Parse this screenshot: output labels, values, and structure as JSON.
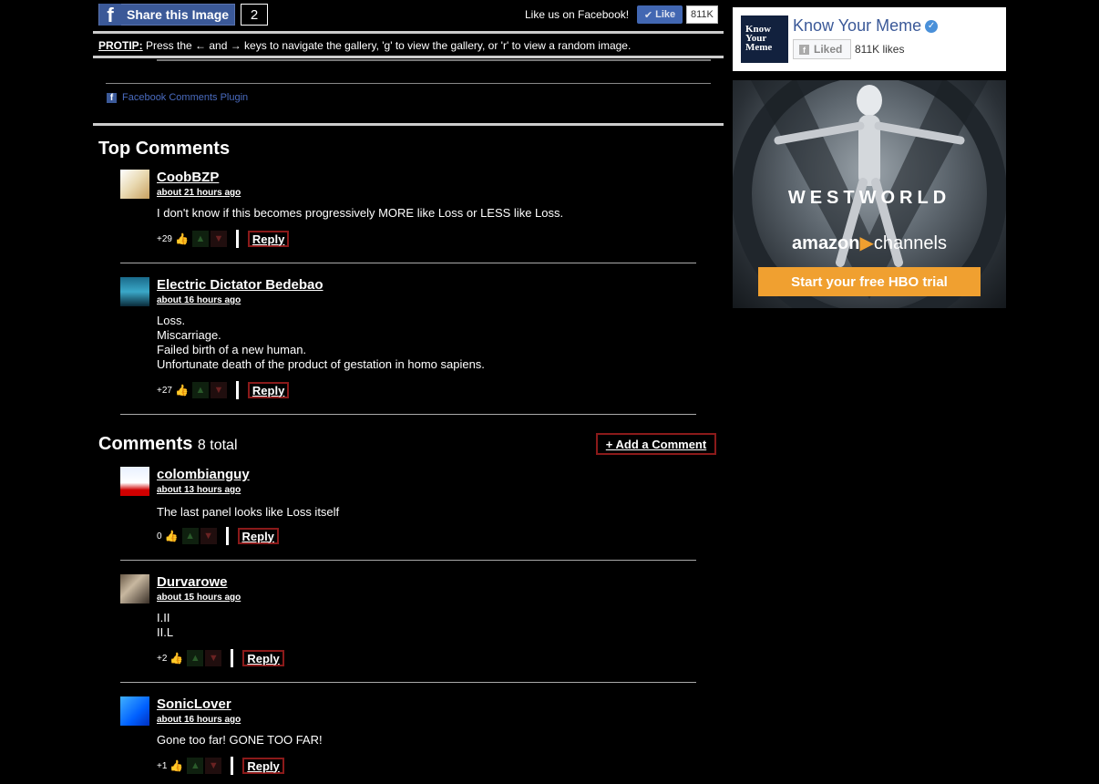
{
  "share": {
    "button_label": "Share this Image",
    "count": "2",
    "like_us": "Like us on Facebook!",
    "like_button": "Like",
    "like_count": "811K"
  },
  "protip": {
    "label": "PROTIP:",
    "text": " Press the ← and → keys to navigate the gallery, 'g' to view the gallery, or 'r' to view a random image."
  },
  "fb_plugin": {
    "label": "Facebook Comments Plugin"
  },
  "top_comments": {
    "title": "Top Comments",
    "items": [
      {
        "user": "CoobBZP",
        "time": "about 21 hours ago",
        "lines": [
          "I don't know if this becomes progressively MORE like Loss or LESS like Loss."
        ],
        "score": "+29",
        "reply": "Reply"
      },
      {
        "user": "Electric Dictator Bedebao",
        "time": "about 16 hours ago",
        "lines": [
          "Loss.",
          "Miscarriage.",
          "Failed birth of a new human.",
          "Unfortunate death of the product of gestation in homo sapiens."
        ],
        "score": "+27",
        "reply": "Reply"
      }
    ]
  },
  "comments": {
    "title": "Comments",
    "total": "8 total",
    "add_label": "+ Add a Comment",
    "items": [
      {
        "user": "colombianguy",
        "time": "about 13 hours ago",
        "lines": [
          "The last panel looks like Loss itself"
        ],
        "score": "0",
        "reply": "Reply"
      },
      {
        "user": "Durvarowe",
        "time": "about 15 hours ago",
        "lines": [
          "I.II",
          "II.L"
        ],
        "score": "+2",
        "reply": "Reply"
      },
      {
        "user": "SonicLover",
        "time": "about 16 hours ago",
        "lines": [
          "Gone too far! GONE TOO FAR!"
        ],
        "score": "+1",
        "reply": "Reply"
      }
    ]
  },
  "sidebar": {
    "page_name": "Know Your Meme",
    "logo_text": [
      "Know",
      "Your",
      "Meme"
    ],
    "liked_label": "Liked",
    "likes": "811K likes"
  },
  "ad": {
    "title": "WESTWORLD",
    "brand": "amazon",
    "brand_suffix": "channels",
    "cta": "Start your free HBO trial"
  },
  "colors": {
    "facebook_blue": "#3b5998",
    "reply_border": "#8b1a1a",
    "ad_cta": "#f0a030"
  }
}
